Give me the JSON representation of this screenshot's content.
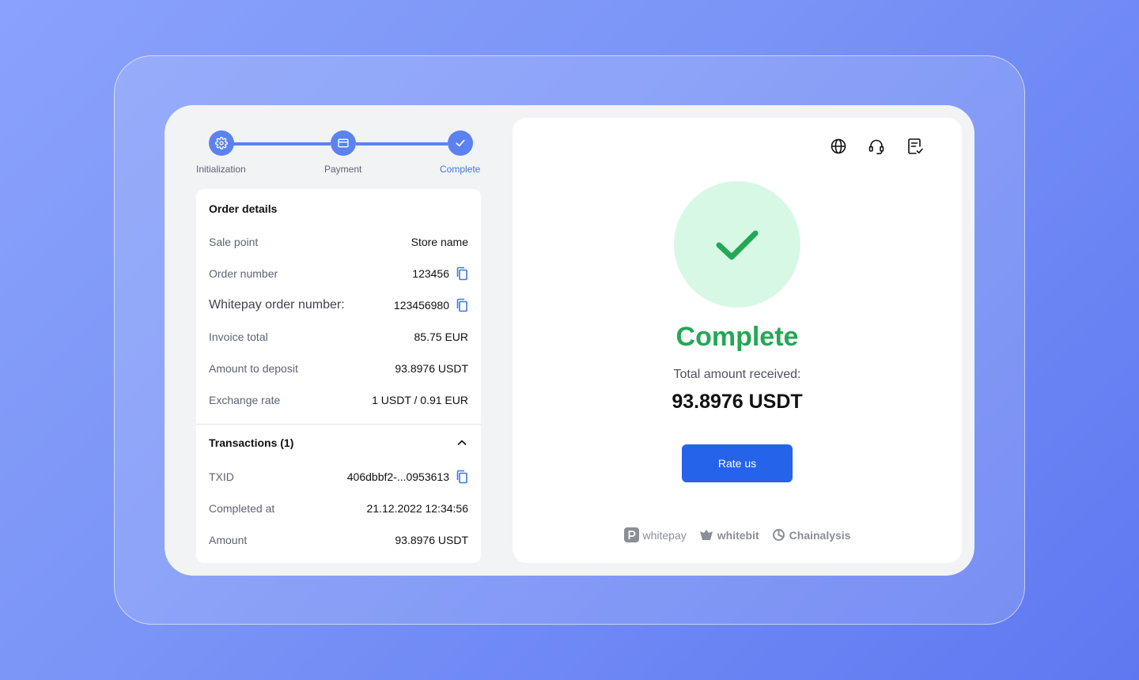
{
  "stepper": {
    "steps": [
      {
        "label": "Initialization",
        "icon": "gear-icon"
      },
      {
        "label": "Payment",
        "icon": "card-icon"
      },
      {
        "label": "Complete",
        "icon": "check-icon"
      }
    ]
  },
  "order": {
    "title": "Order details",
    "rows": [
      {
        "label": "Sale point",
        "value": "Store name"
      },
      {
        "label": "Order number",
        "value": "123456"
      },
      {
        "label": "Whitepay order number:",
        "value": "123456980"
      },
      {
        "label": "Invoice total",
        "value": "85.75 EUR"
      },
      {
        "label": "Amount to deposit",
        "value": "93.8976 USDT"
      },
      {
        "label": "Exchange rate",
        "value": "1 USDT / 0.91 EUR"
      }
    ]
  },
  "transactions": {
    "title": "Transactions (1)",
    "rows": [
      {
        "label": "TXID",
        "value": "406dbbf2-...0953613"
      },
      {
        "label": "Completed at",
        "value": "21.12.2022 12:34:56"
      },
      {
        "label": "Amount",
        "value": "93.8976 USDT"
      }
    ]
  },
  "status": {
    "title": "Complete",
    "total_label": "Total amount received:",
    "total_amount": "93.8976 USDT",
    "rate_button": "Rate us"
  },
  "header_icons": [
    "globe-icon",
    "headset-icon",
    "receipt-check-icon"
  ],
  "brands": [
    "whitepay",
    "whitebit",
    "Chainalysis"
  ],
  "colors": {
    "accent": "#5b82f0",
    "success": "#23a855",
    "success_bg": "#d8f8e6",
    "button": "#2563eb",
    "copy_icon": "#3f75f0"
  }
}
